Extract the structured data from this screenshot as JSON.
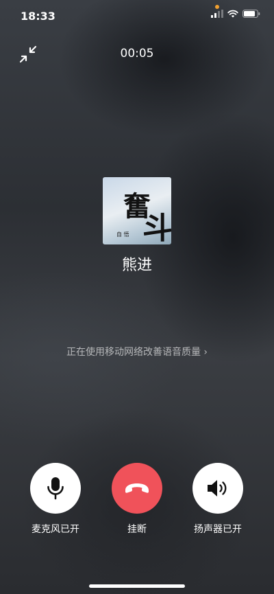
{
  "status_bar": {
    "time": "18:33",
    "icons": [
      "signal-icon",
      "wifi-icon",
      "battery-icon"
    ],
    "indicator_color": "#f0a030"
  },
  "call": {
    "duration": "00:05",
    "caller_name": "熊进",
    "avatar_text": {
      "line1": "奮",
      "line2": "斗",
      "signature": "自 悟"
    },
    "network_hint": "正在使用移动网络改善语音质量",
    "hint_chevron": "›"
  },
  "controls": {
    "mic_label": "麦克风已开",
    "hangup_label": "挂断",
    "speaker_label": "扬声器已开",
    "hangup_color": "#f0525a"
  }
}
